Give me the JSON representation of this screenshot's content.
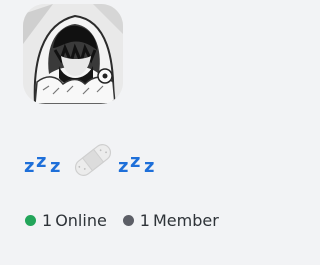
{
  "server": {
    "icon": "anime-hooded-character-icon"
  },
  "emoji_row": [
    {
      "name": "zzz",
      "glyph": "zzz"
    },
    {
      "name": "adhesive_bandage",
      "glyph": "bandage"
    },
    {
      "name": "zzz",
      "glyph": "zzz"
    }
  ],
  "stats": {
    "online_count": "1",
    "online_label": "Online",
    "online_color": "#23a55a",
    "member_count": "1",
    "member_label": "Member",
    "member_color": "#5c5e66"
  },
  "colors": {
    "background": "#f2f3f5",
    "zzz_blue": "#1e6fd9"
  }
}
